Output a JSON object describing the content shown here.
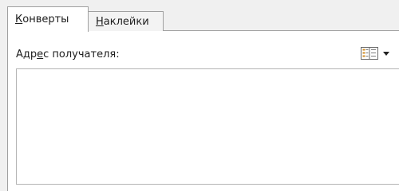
{
  "tabs": [
    {
      "label_first": "К",
      "label_rest": "онверты",
      "active": true
    },
    {
      "label_first": "Н",
      "label_rest": "аклейки",
      "active": false
    }
  ],
  "recipient": {
    "label_before": "Адр",
    "label_mnemonic": "е",
    "label_after": "с получателя:",
    "value": ""
  },
  "icons": {
    "address_book": "address-book-icon",
    "dropdown": "chevron-down-icon"
  }
}
